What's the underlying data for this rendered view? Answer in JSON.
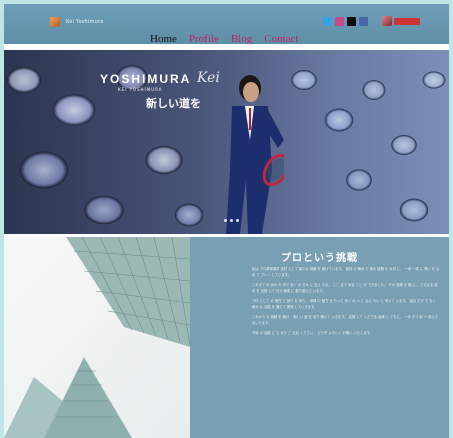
{
  "header": {
    "brand_name": "Kei Yoshimura",
    "menu": [
      "Home",
      "Profile",
      "Blog",
      "Contact"
    ]
  },
  "social_icons": [
    "twitter-icon",
    "instagram-icon",
    "tiktok-icon",
    "facebook-icon"
  ],
  "hero": {
    "title": "YOSHIMURA",
    "script": "Kei",
    "subtitle": "KEI YOSHIMURA",
    "tagline": "新しい道を"
  },
  "section": {
    "title": "プロという挑戦",
    "paragraphs": [
      "私は プロ卓球選手 吉村 として 新たな 挑戦 を 続けています。 競技 の 舞台 で 得た 経験 を 大切 に、 一球 一球 に 想い を 込め て プレー しています。",
      "これまで の 歩み の 中で 多く の 方々 に 支え られ、 ここ まで 来る こと が できました。 その 感謝 を 胸 に、 さらなる 高み を 目指 して 日々 練習 に 取り組んで います。",
      "プロ として の 責任 と 誇り を 持ち、 卓球 の 魅力 を もっと 多く の 人 に 伝え たい と 考えて います。 試合 だけ で なく 様々 な 活動 を 通じて 発信 していきます。",
      "これから も 挑戦 を 続け、 新しい 道 を 切り 開いて いきます。 応援 して くださる 皆様 と ともに、 一歩 ずつ 前 へ 進んで まいります。",
      "今後 の 活動 に も ぜひ ご 注目 ください。 どうぞ よろしく お願い いたします。"
    ]
  },
  "colors": {
    "menu_home": "#111111",
    "menu_accent": "#c21f6a",
    "topbar": "#6f9fb8",
    "section_bg": "#789fb3"
  }
}
